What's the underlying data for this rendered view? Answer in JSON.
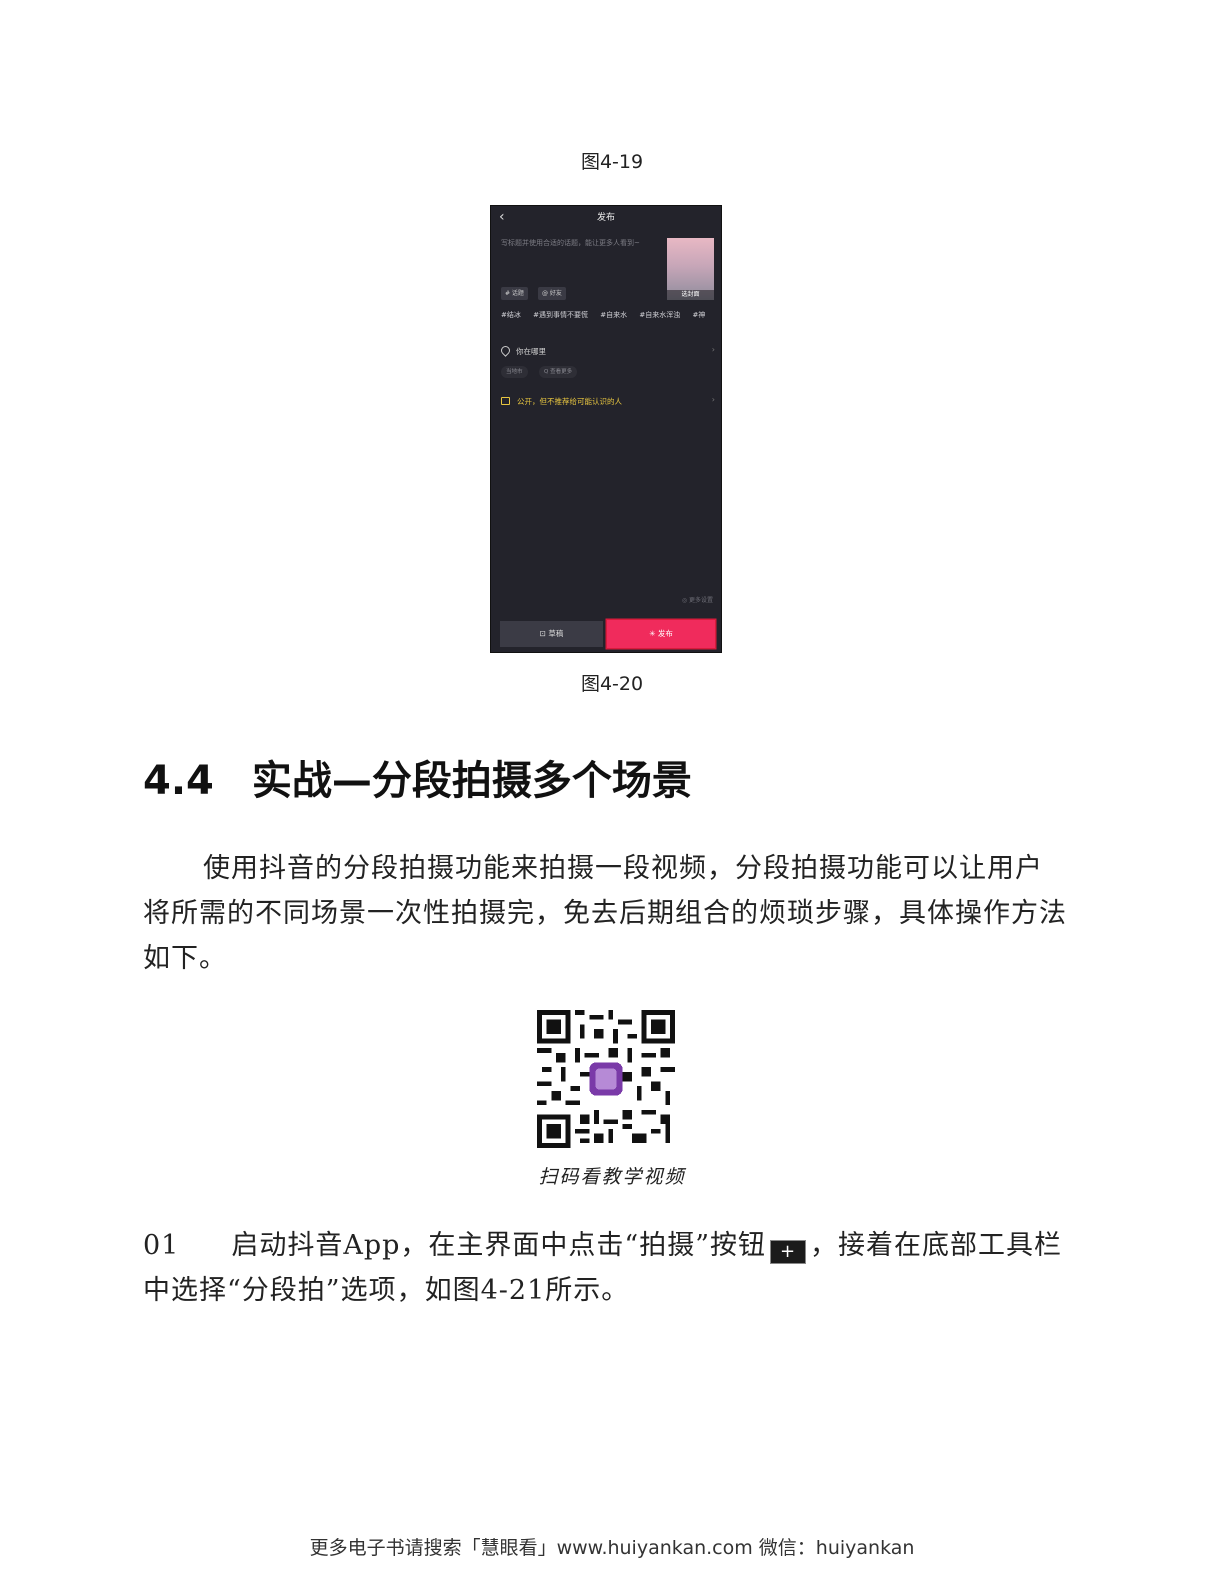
{
  "figure_top_caption": "图4-19",
  "phone": {
    "back_icon": "chevron-left-icon",
    "title": "发布",
    "description_placeholder": "写标题并使用合适的话题，能让更多人看到~",
    "cover_label": "选封面",
    "chip_topic": "# 话题",
    "chip_friend": "@ 好友",
    "hashtags": [
      "#结冰",
      "#遇到事情不要慌",
      "#自来水",
      "#自来水浑浊",
      "#神"
    ],
    "location_label": "你在哪里",
    "location_chip_1": "当地市",
    "location_chip_2": "Q 查看更多",
    "privacy_label": "公开，但不推荐给可能认识的人",
    "more_settings": "◎ 更多设置",
    "draft_button": "草稿",
    "publish_button": "发布",
    "accent_color": "#f02b5c"
  },
  "figure_bottom_caption": "图4-20",
  "section": {
    "number": "4.4",
    "title": "实战—分段拍摄多个场景"
  },
  "intro_paragraph": "使用抖音的分段拍摄功能来拍摄一段视频，分段拍摄功能可以让用户将所需的不同场景一次性拍摄完，免去后期组合的烦琐步骤，具体操作方法如下。",
  "qr_caption": "扫码看教学视频",
  "step": {
    "number": "01",
    "text_before_icon": "启动抖音App，在主界面中点击“拍摄”按钮",
    "icon_glyph": "+",
    "text_after_icon": "，接着在底部工具栏中选择“分段拍”选项，如图4-21所示。"
  },
  "footer": "更多电子书请搜索「慧眼看」www.huiyankan.com  微信：huiyankan"
}
